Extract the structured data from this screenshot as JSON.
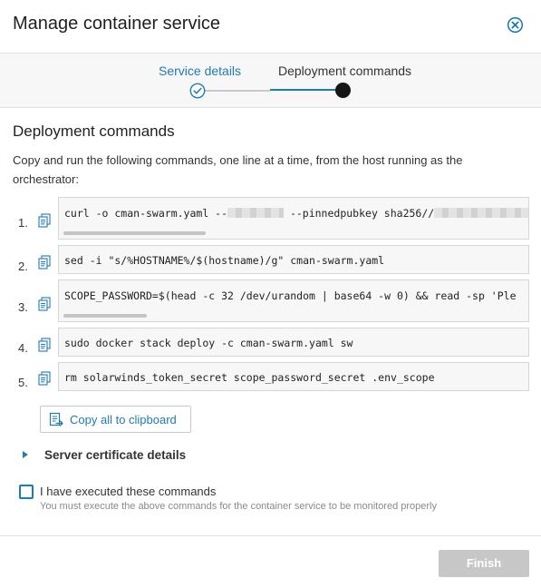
{
  "dialog": {
    "title": "Manage container service"
  },
  "stepper": {
    "steps": [
      {
        "label": "Service details",
        "state": "completed"
      },
      {
        "label": "Deployment commands",
        "state": "active"
      }
    ]
  },
  "section": {
    "title": "Deployment commands",
    "intro": "Copy and run the following commands, one line at a time, from the host running as the orchestrator:"
  },
  "commands": [
    {
      "number": "1.",
      "text_before_mask": "curl -o cman-swarm.yaml --",
      "text_after_mask": " --pinnedpubkey sha256//",
      "redacted": true
    },
    {
      "number": "2.",
      "text": "sed -i \"s/%HOSTNAME%/$(hostname)/g\" cman-swarm.yaml"
    },
    {
      "number": "3.",
      "text": "SCOPE_PASSWORD=$(head -c 32 /dev/urandom | base64 -w 0) && read -sp 'Ple"
    },
    {
      "number": "4.",
      "text": "sudo docker stack deploy -c cman-swarm.yaml sw"
    },
    {
      "number": "5.",
      "text": "rm solarwinds_token_secret scope_password_secret .env_scope"
    }
  ],
  "copy_all": {
    "label": "Copy all to clipboard",
    "icon": "clipboard-copy-icon"
  },
  "certificate": {
    "label": "Server certificate details",
    "expanded": false
  },
  "confirmation": {
    "label": "I have executed these commands",
    "hint": "You must execute the above commands for the container service to be monitored properly",
    "checked": false
  },
  "footer": {
    "finish_label": "Finish",
    "finish_enabled": false
  },
  "colors": {
    "accent": "#1f7bb6",
    "disabled_button": "#c7c7c7",
    "active_step_dot": "#161616"
  }
}
